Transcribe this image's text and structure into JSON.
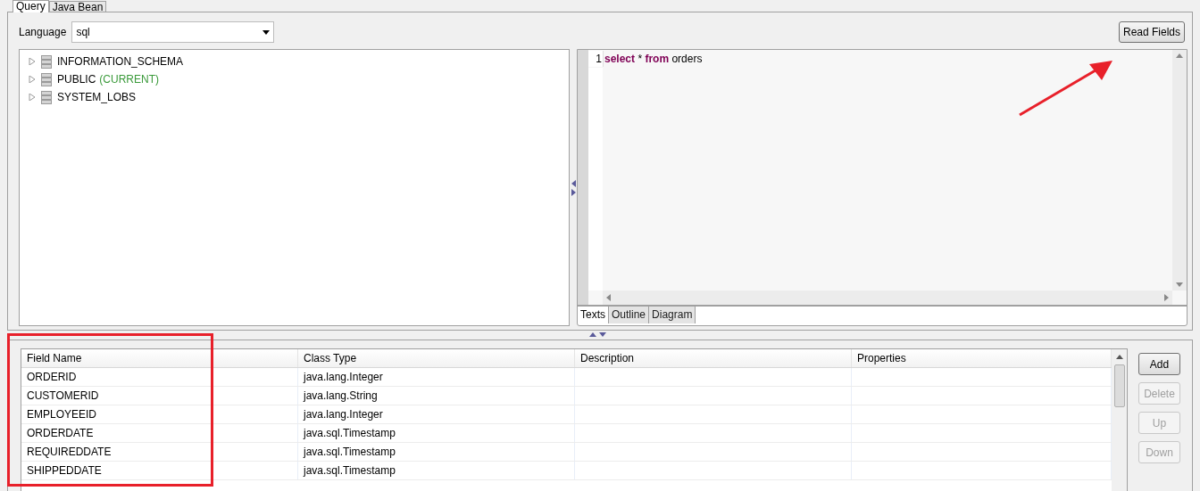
{
  "tabs": [
    {
      "label": "Query",
      "selected": true
    },
    {
      "label": "Java Bean",
      "selected": false
    }
  ],
  "language": {
    "label": "Language",
    "value": "sql"
  },
  "read_fields_button": "Read Fields",
  "schema_tree": [
    {
      "name": "INFORMATION_SCHEMA",
      "expanded": false
    },
    {
      "name": "PUBLIC",
      "note": "(CURRENT)",
      "expanded": false
    },
    {
      "name": "SYSTEM_LOBS",
      "expanded": false
    }
  ],
  "editor": {
    "lines": [
      {
        "number": "1",
        "tokens": [
          {
            "kind": "keyword",
            "text": "select"
          },
          {
            "kind": "plain",
            "text": "*"
          },
          {
            "kind": "keyword",
            "text": "from"
          },
          {
            "kind": "plain",
            "text": "orders"
          }
        ]
      }
    ],
    "tabs": [
      {
        "label": "Texts",
        "selected": true
      },
      {
        "label": "Outline",
        "selected": false
      },
      {
        "label": "Diagram",
        "selected": false
      }
    ]
  },
  "table": {
    "columns": [
      "Field Name",
      "Class Type",
      "Description",
      "Properties"
    ],
    "rows": [
      [
        "ORDERID",
        "java.lang.Integer",
        "",
        ""
      ],
      [
        "CUSTOMERID",
        "java.lang.String",
        "",
        ""
      ],
      [
        "EMPLOYEEID",
        "java.lang.Integer",
        "",
        ""
      ],
      [
        "ORDERDATE",
        "java.sql.Timestamp",
        "",
        ""
      ],
      [
        "REQUIREDDATE",
        "java.sql.Timestamp",
        "",
        ""
      ],
      [
        "SHIPPEDDATE",
        "java.sql.Timestamp",
        "",
        ""
      ]
    ]
  },
  "buttons": [
    {
      "label": "Add",
      "disabled": false
    },
    {
      "label": "Delete",
      "disabled": true
    },
    {
      "label": "Up",
      "disabled": true
    },
    {
      "label": "Down",
      "disabled": true
    }
  ]
}
